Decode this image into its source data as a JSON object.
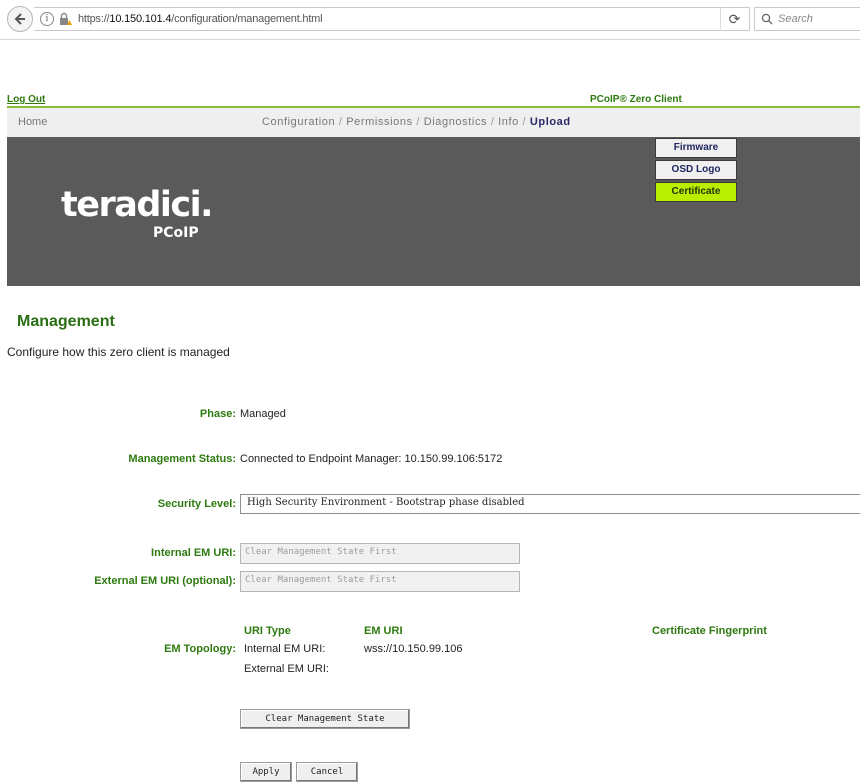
{
  "browser": {
    "url_prefix": "https://",
    "url_host": "10.150.101.4",
    "url_path": "/configuration/management.html",
    "search_placeholder": "Search"
  },
  "header": {
    "logout": "Log Out",
    "product": "PCoIP® Zero Client"
  },
  "nav": {
    "home": "Home",
    "items": [
      "Configuration",
      "Permissions",
      "Diagnostics",
      "Info",
      "Upload"
    ],
    "separator": "/"
  },
  "upload_menu": [
    "Firmware",
    "OSD Logo",
    "Certificate"
  ],
  "logo": {
    "main": "teradici.",
    "sub": "PCoIP"
  },
  "page": {
    "title": "Management",
    "description": "Configure how this zero client is managed"
  },
  "fields": {
    "phase_label": "Phase:",
    "phase_value": "Managed",
    "status_label": "Management Status:",
    "status_value": "Connected to Endpoint Manager: 10.150.99.106:5172",
    "security_label": "Security Level:",
    "security_value": "High Security Environment - Bootstrap phase disabled",
    "internal_label": "Internal EM URI:",
    "internal_placeholder": "Clear Management State First",
    "external_label": "External EM URI (optional):",
    "external_placeholder": "Clear Management State First"
  },
  "topology": {
    "label": "EM Topology:",
    "headers": [
      "URI Type",
      "EM URI",
      "Certificate Fingerprint"
    ],
    "rows": [
      {
        "type": "Internal EM URI:",
        "uri": "wss://10.150.99.106"
      },
      {
        "type": "External EM URI:",
        "uri": ""
      }
    ]
  },
  "buttons": {
    "clear": "Clear Management State",
    "apply": "Apply",
    "cancel": "Cancel"
  },
  "colors": {
    "label_green": "#2d7a0f",
    "banner_gray": "#5a5a5a",
    "highlight": "#b9ee00"
  }
}
